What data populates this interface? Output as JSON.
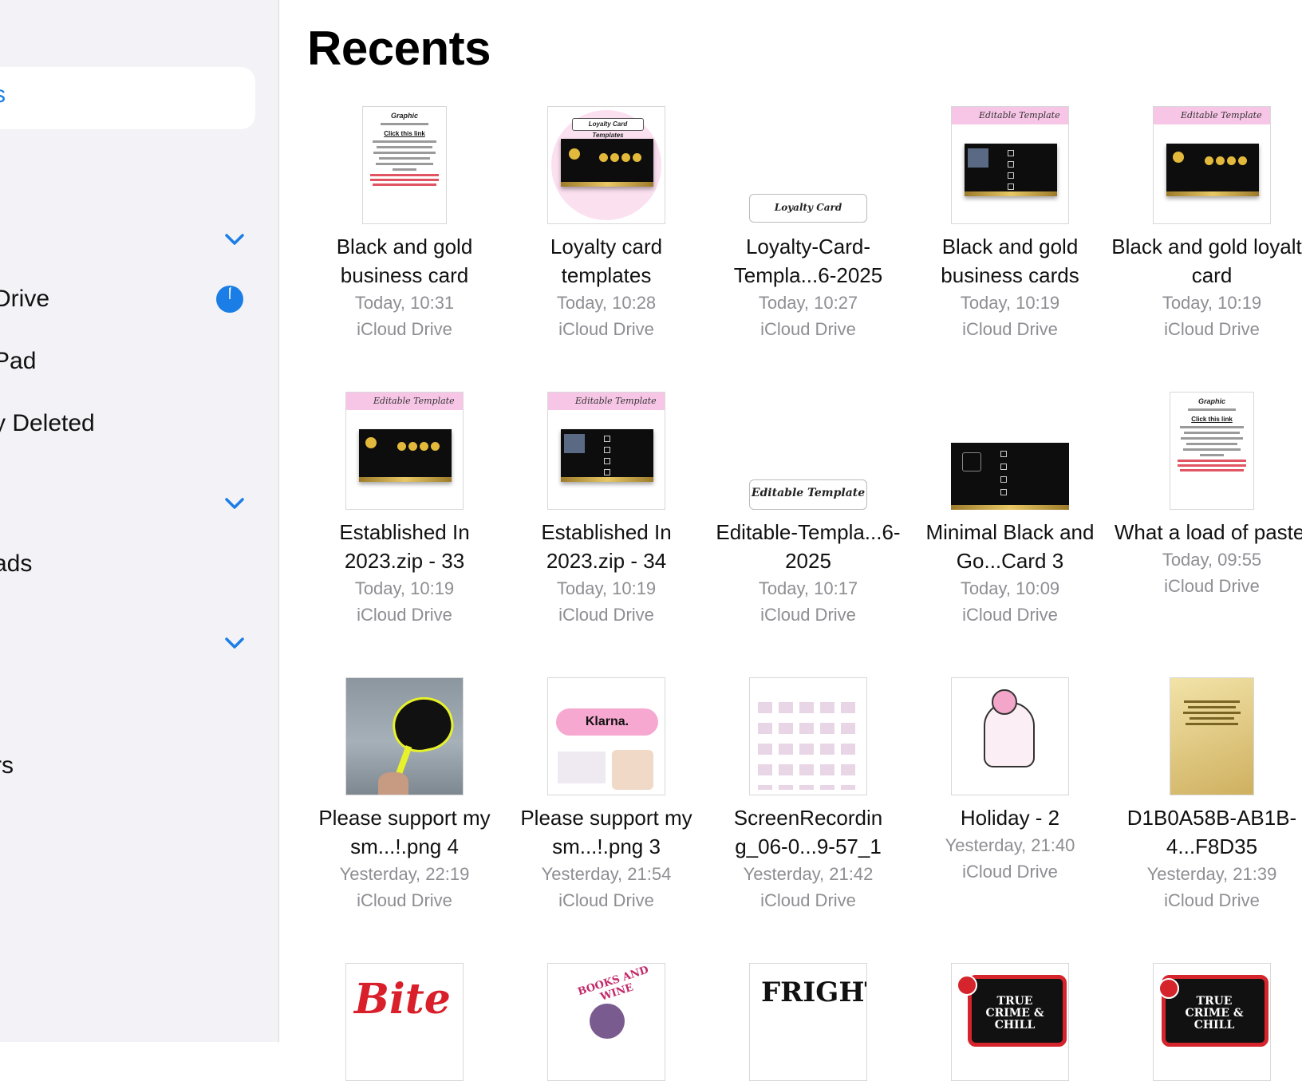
{
  "sidebar": {
    "selected_label": "s",
    "items": [
      {
        "label": "Drive"
      },
      {
        "label": "Pad"
      },
      {
        "label": "y Deleted"
      },
      {
        "label": "ads"
      },
      {
        "label": "rs"
      }
    ]
  },
  "main": {
    "title": "Recents",
    "files": [
      {
        "name": "Black and gold business card",
        "date": "Today, 10:31",
        "location": "iCloud Drive"
      },
      {
        "name": "Loyalty card templates",
        "date": "Today, 10:28",
        "location": "iCloud Drive"
      },
      {
        "name": "Loyalty-Card-Templa...6-2025",
        "date": "Today, 10:27",
        "location": "iCloud Drive"
      },
      {
        "name": "Black and gold business cards",
        "date": "Today, 10:19",
        "location": "iCloud Drive"
      },
      {
        "name": "Black and gold loyalty card",
        "date": "Today, 10:19",
        "location": "iCloud Drive"
      },
      {
        "name": "Established In 2023.zip - 33",
        "date": "Today, 10:19",
        "location": "iCloud Drive"
      },
      {
        "name": "Established In 2023.zip - 34",
        "date": "Today, 10:19",
        "location": "iCloud Drive"
      },
      {
        "name": "Editable-Templa...6-2025",
        "date": "Today, 10:17",
        "location": "iCloud Drive"
      },
      {
        "name": "Minimal Black and Go...Card 3",
        "date": "Today, 10:09",
        "location": "iCloud Drive"
      },
      {
        "name": "What a load of pastel",
        "date": "Today, 09:55",
        "location": "iCloud Drive"
      },
      {
        "name": "Please support my sm...!.png 4",
        "date": "Yesterday, 22:19",
        "location": "iCloud Drive"
      },
      {
        "name": "Please support my sm...!.png 3",
        "date": "Yesterday, 21:54",
        "location": "iCloud Drive"
      },
      {
        "name": "ScreenRecordin g_06-0...9-57_1",
        "date": "Yesterday, 21:42",
        "location": "iCloud Drive"
      },
      {
        "name": "Holiday - 2",
        "date": "Yesterday, 21:40",
        "location": "iCloud Drive"
      },
      {
        "name": "D1B0A58B-AB1B-4...F8D35",
        "date": "Yesterday, 21:39",
        "location": "iCloud Drive"
      }
    ],
    "thumb_texts": {
      "click_link": "Click this link",
      "loyalty_label": "Loyalty Card Templates",
      "editable_label": "Editable Template",
      "klarna": "Klarna.",
      "bite": "Bite",
      "fright": "FRIGHT",
      "true_crime": "TRUE CRIME & CHILL",
      "books": "BOOKS AND WINE"
    }
  },
  "colors": {
    "accent": "#1a7ee6",
    "sidebar_bg": "#f2f2f7",
    "meta_gray": "#8e8e93"
  }
}
